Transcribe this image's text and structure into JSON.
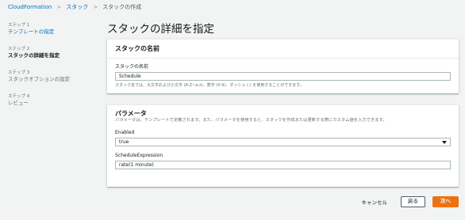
{
  "breadcrumb": {
    "items": [
      "CloudFormation",
      "スタック",
      "スタックの作成"
    ]
  },
  "sidebar": {
    "steps": [
      {
        "num": "ステップ 1",
        "label": "テンプレートの指定"
      },
      {
        "num": "ステップ 2",
        "label": "スタックの詳細を指定"
      },
      {
        "num": "ステップ 3",
        "label": "スタックオプションの設定"
      },
      {
        "num": "ステップ 4",
        "label": "レビュー"
      }
    ]
  },
  "page": {
    "title": "スタックの詳細を指定"
  },
  "stack_name_panel": {
    "header": "スタックの名前",
    "field_label": "スタックの名前",
    "value": "Schedule",
    "hint": "スタック名では、大文字および小文字 (A-Z~a-z)、数字 (0-9)、ダッシュ (-) を使用することができます。"
  },
  "parameters_panel": {
    "header": "パラメータ",
    "description": "パラメータは、テンプレートで定義されます。また、パラメータを使用すると、スタックを作成または更新する際にカスタム値を入力できます。",
    "enabled_label": "Enabled",
    "enabled_value": "true",
    "schedule_label": "ScheduleExpression",
    "schedule_value": "rate(1 minute)"
  },
  "footer": {
    "cancel": "キャンセル",
    "back": "戻る",
    "next": "次へ"
  }
}
